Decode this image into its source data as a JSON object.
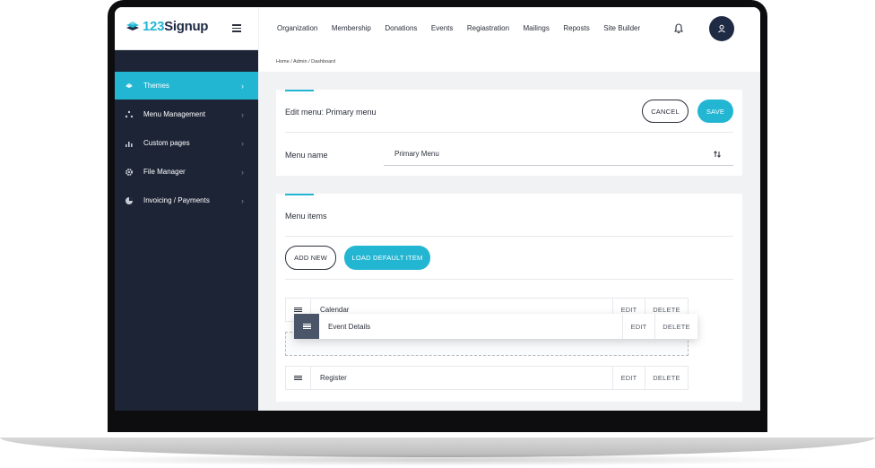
{
  "brand": {
    "logo_text": "Signup",
    "logo_number": "123",
    "accent": "#23b6d3",
    "navy": "#1f2a44",
    "sidebar_bg": "#1c2436"
  },
  "topnav": [
    {
      "label": "Organization"
    },
    {
      "label": "Membership"
    },
    {
      "label": "Donations"
    },
    {
      "label": "Events"
    },
    {
      "label": "Regiastration"
    },
    {
      "label": "Mailings"
    },
    {
      "label": "Reposts"
    },
    {
      "label": "Site Builder"
    }
  ],
  "header_icons": {
    "menu": "hamburger-icon",
    "notifications": "bell-icon",
    "profile": "user-icon"
  },
  "sidebar": {
    "items": [
      {
        "label": "Themes",
        "icon": "layers-icon",
        "active": true
      },
      {
        "label": "Menu Management",
        "icon": "nodes-icon",
        "active": false
      },
      {
        "label": "Custom pages",
        "icon": "chart-icon",
        "active": false
      },
      {
        "label": "File Manager",
        "icon": "gear-icon",
        "active": false
      },
      {
        "label": "Invoicing / Payments",
        "icon": "pie-icon",
        "active": false
      }
    ]
  },
  "breadcrumb": "Home / Admin / Dashboard",
  "edit_card": {
    "title": "Edit menu: Primary menu",
    "cancel_label": "CANCEL",
    "save_label": "SAVE",
    "menu_name_label": "Menu name",
    "menu_name_value": "Primary Menu"
  },
  "items_card": {
    "title": "Menu items",
    "add_new_label": "ADD NEW",
    "load_default_label": "LOAD DEFAULT ITEM",
    "edit_label": "EDIT",
    "delete_label": "DELETE",
    "rows": [
      {
        "label": "Calendar"
      },
      {
        "label": "Event Details",
        "dragging": true
      },
      {
        "label": "Register"
      }
    ]
  }
}
